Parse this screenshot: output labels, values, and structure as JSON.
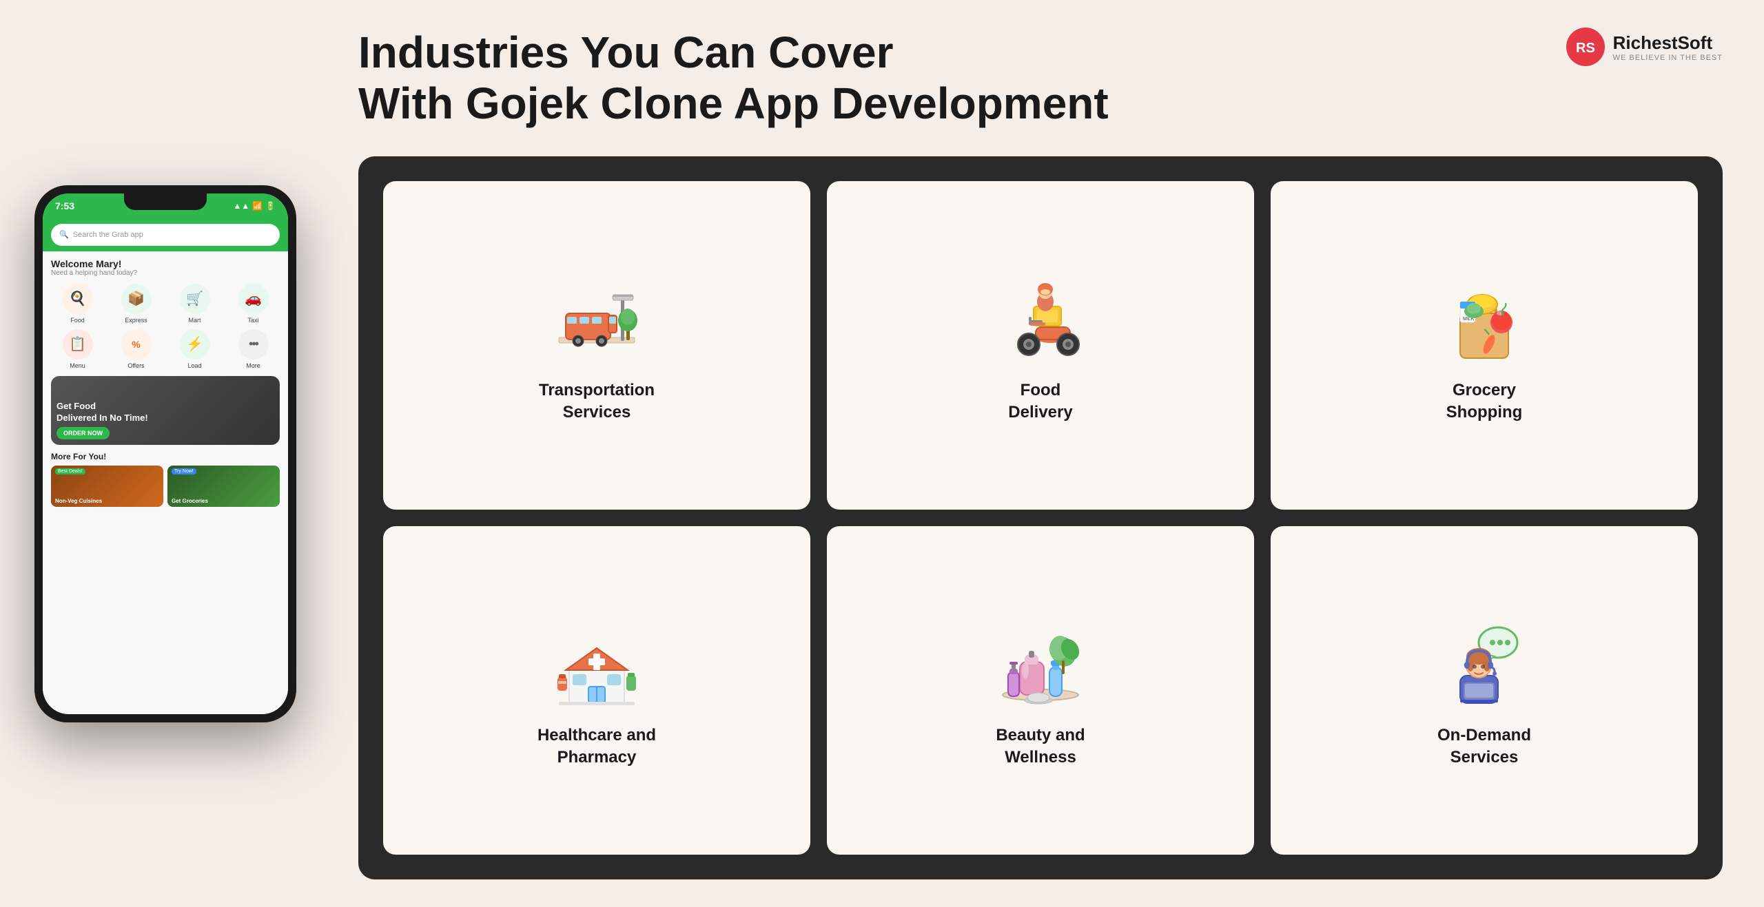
{
  "page": {
    "background_color": "#f5ede8"
  },
  "phone": {
    "time": "7:53",
    "search_placeholder": "Search the Grab app",
    "welcome_title": "Welcome Mary!",
    "welcome_subtitle": "Need a helping hand today?",
    "app_items": [
      {
        "label": "Food",
        "icon": "🍳",
        "style": "orange"
      },
      {
        "label": "Express",
        "icon": "📦",
        "style": "green"
      },
      {
        "label": "Mart",
        "icon": "🛒",
        "style": "green"
      },
      {
        "label": "Taxi",
        "icon": "🚗",
        "style": "green"
      },
      {
        "label": "Menu",
        "icon": "📋",
        "style": "red"
      },
      {
        "label": "Offers",
        "icon": "%",
        "style": "orange"
      },
      {
        "label": "Load",
        "icon": "⚡",
        "style": "green"
      },
      {
        "label": "More",
        "icon": "•••",
        "style": "gray"
      }
    ],
    "promo": {
      "text": "Get Food\nDelivered In No Time!",
      "button": "ORDER NOW"
    },
    "more_section": "More For You!",
    "more_items": [
      {
        "label": "Non-Veg Cuisines\nUnlock the Magic of Non-Veg Food",
        "badge": "Best Deals!",
        "badge_style": "green"
      },
      {
        "label": "Get Groceries\nDelivered At Your DoorStep!",
        "badge": "Try Now!",
        "badge_style": "blue"
      }
    ]
  },
  "header": {
    "title_line1": "Industries You Can Cover",
    "title_line2": "With Gojek Clone App Development"
  },
  "brand": {
    "name": "RichestSoft",
    "tagline": "WE BELIEVE IN THE BEST",
    "icon": "RS"
  },
  "industries": [
    {
      "label": "Transportation\nServices",
      "icon_type": "transportation"
    },
    {
      "label": "Food\nDelivery",
      "icon_type": "food_delivery"
    },
    {
      "label": "Grocery\nShopping",
      "icon_type": "grocery"
    },
    {
      "label": "Healthcare and\nPharmacy",
      "icon_type": "healthcare"
    },
    {
      "label": "Beauty and\nWellness",
      "icon_type": "beauty"
    },
    {
      "label": "On-Demand\nServices",
      "icon_type": "ondemand"
    }
  ]
}
